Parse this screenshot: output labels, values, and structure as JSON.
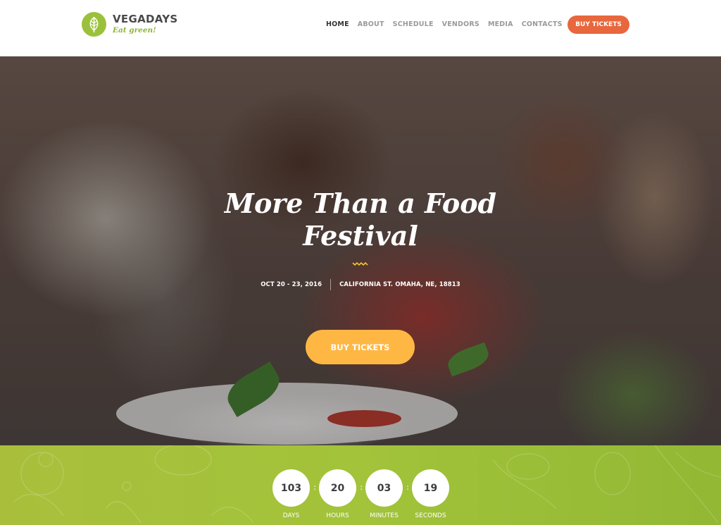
{
  "header": {
    "logo": {
      "name": "VEGADAYS",
      "tagline": "Eat green!",
      "icon": "leaf-icon"
    },
    "nav": [
      {
        "label": "HOME",
        "active": true
      },
      {
        "label": "ABOUT",
        "active": false
      },
      {
        "label": "SCHEDULE",
        "active": false
      },
      {
        "label": "VENDORS",
        "active": false
      },
      {
        "label": "MEDIA",
        "active": false
      },
      {
        "label": "CONTACTS",
        "active": false
      }
    ],
    "cta_label": "BUY TICKETS"
  },
  "hero": {
    "title_line1": "More Than a Food",
    "title_line2": "Festival",
    "date": "OCT 20 - 23, 2016",
    "location": "CALIFORNIA ST. OMAHA, NE, 18813",
    "cta_label": "BUY TICKETS"
  },
  "countdown": {
    "units": [
      {
        "value": "103",
        "label": "DAYS"
      },
      {
        "value": "20",
        "label": "HOURS"
      },
      {
        "value": "03",
        "label": "MINUTES"
      },
      {
        "value": "19",
        "label": "SECONDS"
      }
    ]
  },
  "colors": {
    "brand_green": "#9bc13c",
    "header_cta": "#e8673d",
    "hero_cta": "#ffb744",
    "countdown_bg": "#a2c33a"
  }
}
